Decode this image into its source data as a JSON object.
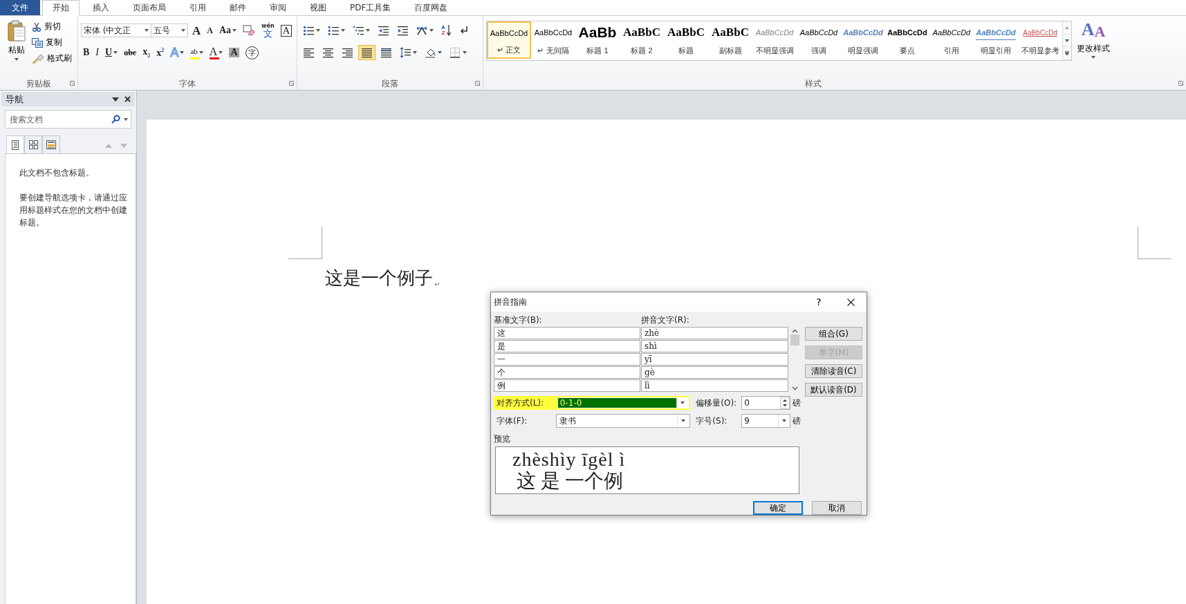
{
  "ribbon_tabs": [
    {
      "label": "文件",
      "kind": "file",
      "selected": false
    },
    {
      "label": "开始",
      "kind": "tab",
      "selected": true
    },
    {
      "label": "插入",
      "kind": "tab",
      "selected": false
    },
    {
      "label": "页面布局",
      "kind": "tab",
      "selected": false
    },
    {
      "label": "引用",
      "kind": "tab",
      "selected": false
    },
    {
      "label": "邮件",
      "kind": "tab",
      "selected": false
    },
    {
      "label": "审阅",
      "kind": "tab",
      "selected": false
    },
    {
      "label": "视图",
      "kind": "tab",
      "selected": false
    },
    {
      "label": "PDF工具集",
      "kind": "tab",
      "selected": false
    },
    {
      "label": "百度网盘",
      "kind": "tab",
      "selected": false
    }
  ],
  "clipboard": {
    "paste": "粘贴",
    "items": [
      {
        "kind": "cut",
        "label": "剪切"
      },
      {
        "kind": "copy",
        "label": "复制"
      },
      {
        "kind": "painter",
        "label": "格式刷"
      }
    ],
    "group_label": "剪贴板"
  },
  "font": {
    "font_name": "宋体 (中文正",
    "font_size": "五号",
    "row1": [
      {
        "kind": "grow",
        "label": "A"
      },
      {
        "kind": "shrink",
        "label": "A"
      },
      {
        "kind": "case",
        "label": "Aa",
        "menu": true
      },
      {
        "kind": "clear"
      },
      {
        "kind": "phonetic",
        "ruby": "wén",
        "label": "文"
      },
      {
        "kind": "charborder",
        "label": "A"
      }
    ],
    "row2": [
      {
        "kind": "bold",
        "label": "B"
      },
      {
        "kind": "italic",
        "label": "I"
      },
      {
        "kind": "underline",
        "label": "U",
        "menu": true
      },
      {
        "kind": "strike",
        "label": "abc"
      },
      {
        "kind": "sub",
        "label": "x",
        "script": "2"
      },
      {
        "kind": "sup",
        "label": "x",
        "script": "2"
      },
      {
        "kind": "effects",
        "label": "A",
        "menu": true
      },
      {
        "kind": "highlight",
        "label": "ab",
        "menu": true
      },
      {
        "kind": "fontcolor",
        "label": "A",
        "menu": true
      },
      {
        "kind": "shading",
        "label": "A"
      },
      {
        "kind": "enclose",
        "label": "字"
      }
    ],
    "group_label": "字体"
  },
  "paragraph": {
    "row1": [
      {
        "kind": "bullets",
        "menu": true
      },
      {
        "kind": "numbering",
        "menu": true
      },
      {
        "kind": "multilevel",
        "menu": true
      },
      {
        "kind": "outdent"
      },
      {
        "kind": "indent"
      },
      {
        "kind": "asian",
        "menu": true
      },
      {
        "kind": "sort",
        "letters": [
          "A",
          "Z"
        ]
      },
      {
        "kind": "marks"
      }
    ],
    "row2": [
      {
        "kind": "align-left",
        "selected": false
      },
      {
        "kind": "align-center",
        "selected": false
      },
      {
        "kind": "align-right",
        "selected": false
      },
      {
        "kind": "justify",
        "selected": true
      },
      {
        "kind": "distributed",
        "selected": false
      },
      {
        "kind": "linespacing",
        "menu": true,
        "selected": false
      },
      {
        "kind": "shading",
        "menu": true,
        "selected": false
      },
      {
        "kind": "borders",
        "menu": true,
        "selected": false
      }
    ],
    "group_label": "段落"
  },
  "styles": {
    "items": [
      {
        "preview": "AaBbCcDd",
        "name": "↵ 正文",
        "kind": "normal",
        "selected": true
      },
      {
        "preview": "AaBbCcDd",
        "name": "↵ 无间隔",
        "kind": "normal",
        "selected": false
      },
      {
        "preview": "AaBb",
        "name": "标题 1",
        "kind": "title",
        "selected": false
      },
      {
        "preview": "AaBbC",
        "name": "标题 2",
        "kind": "heading",
        "selected": false
      },
      {
        "preview": "AaBbC",
        "name": "标题",
        "kind": "heading",
        "selected": false
      },
      {
        "preview": "AaBbC",
        "name": "副标题",
        "kind": "heading",
        "selected": false
      },
      {
        "preview": "AaBbCcDd",
        "name": "不明显强调",
        "kind": "subtle",
        "selected": false
      },
      {
        "preview": "AaBbCcDd",
        "name": "强调",
        "kind": "emphasis",
        "selected": false
      },
      {
        "preview": "AaBbCcDd",
        "name": "明显强调",
        "kind": "intense",
        "selected": false
      },
      {
        "preview": "AaBbCcDd",
        "name": "要点",
        "kind": "strong",
        "selected": false
      },
      {
        "preview": "AaBbCcDd",
        "name": "引用",
        "kind": "emphasis",
        "selected": false
      },
      {
        "preview": "AaBbCcDd",
        "name": "明显引用",
        "kind": "intense-quote",
        "selected": false
      },
      {
        "preview": "AaBbCcDd",
        "name": "不明显参考",
        "kind": "subtle-ref",
        "selected": false
      }
    ],
    "group_label": "样式",
    "change_styles": {
      "glyphs": [
        "A",
        "A"
      ],
      "label": "更改样式"
    }
  },
  "navigation": {
    "title": "导航",
    "search_placeholder": "搜索文档",
    "tabs": [
      {
        "kind": "headings",
        "selected": true
      },
      {
        "kind": "pages",
        "selected": false
      },
      {
        "kind": "results",
        "selected": false
      }
    ],
    "messages": [
      "此文档不包含标题。",
      "要创建导航选项卡，请通过应用标题样式在您的文档中创建标题。"
    ]
  },
  "document": {
    "text": "这是一个例子",
    "mark": "↵"
  },
  "dialog": {
    "title": "拼音指南",
    "help": "?",
    "base_label": "基准文字(B):",
    "ruby_label": "拼音文字(R):",
    "rows": [
      {
        "base": "这",
        "ruby": "zhè"
      },
      {
        "base": "是",
        "ruby": "shì"
      },
      {
        "base": "一",
        "ruby": "yī"
      },
      {
        "base": "个",
        "ruby": "gè"
      },
      {
        "base": "例",
        "ruby": "lì"
      }
    ],
    "buttons": [
      {
        "label": "组合(G)",
        "disabled": false
      },
      {
        "label": "单字(M)",
        "disabled": true
      },
      {
        "label": "清除读音(C)",
        "disabled": false
      },
      {
        "label": "默认读音(D)",
        "disabled": false
      }
    ],
    "alignment": {
      "label": "对齐方式(L):",
      "value": "0-1-0",
      "highlighted": true
    },
    "offset": {
      "label": "偏移量(O):",
      "value": "0",
      "unit": "磅"
    },
    "font": {
      "label": "字体(F):",
      "value": "隶书"
    },
    "size": {
      "label": "字号(S):",
      "value": "9",
      "unit": "磅"
    },
    "preview_label": "预览",
    "preview": {
      "ruby": "zhèshìy īgèl ì",
      "base": "这 是 一个例"
    },
    "ok": "确定",
    "cancel": "取消"
  }
}
